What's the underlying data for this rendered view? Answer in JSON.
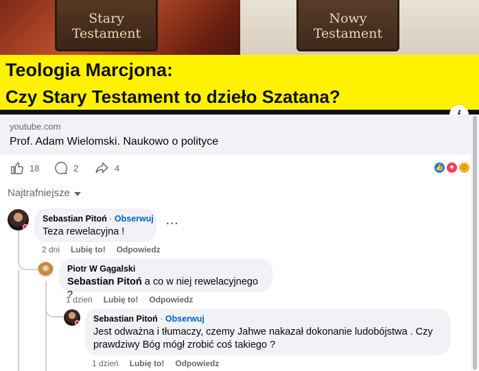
{
  "link_preview": {
    "book_left": [
      "Stary",
      "Testament"
    ],
    "book_right": [
      "Nowy",
      "Testament"
    ],
    "headline_line1": "Teologia Marcjona:",
    "headline_line2": "Czy Stary Testament to dzieło Szatana?",
    "info_icon": "i",
    "domain": "youtube.com",
    "title": "Prof. Adam Wielomski. Naukowo o polityce"
  },
  "actions": {
    "likes": "18",
    "comments": "2",
    "shares": "4",
    "reactions": [
      "like-icon",
      "love-icon",
      "haha-icon"
    ]
  },
  "sort": {
    "label": "Najtrafniejsze"
  },
  "comments": [
    {
      "author": "Sebastian Pitoń",
      "follow_sep": " · ",
      "follow": "Obserwuj",
      "text": "Teza rewelacyjna !",
      "time": "2 dni",
      "like": "Lubię to!",
      "reply": "Odpowiedz",
      "menu": "···"
    },
    {
      "author": "Piotr W Gągalski",
      "mention": "Sebastian Pitoń",
      "text": " a co w niej rewelacyjnego ?",
      "time": "1 dzień",
      "like": "Lubię to!",
      "reply": "Odpowiedz"
    },
    {
      "author": "Sebastian Pitoń",
      "follow_sep": " · ",
      "follow": "Obserwuj",
      "text": "Jest odważna i tłumaczy, czemy Jahwe nakazał dokonanie ludobójstwa . Czy prawdziwy Bóg mógł zrobić coś takiego ?",
      "time": "1 dzień",
      "like": "Lubię to!",
      "reply": "Odpowiedz"
    }
  ],
  "colors": {
    "bubble": "#f0f2f5",
    "secondary_text": "#65676b",
    "link_blue": "#0064d1",
    "banner_yellow": "#fff200"
  }
}
